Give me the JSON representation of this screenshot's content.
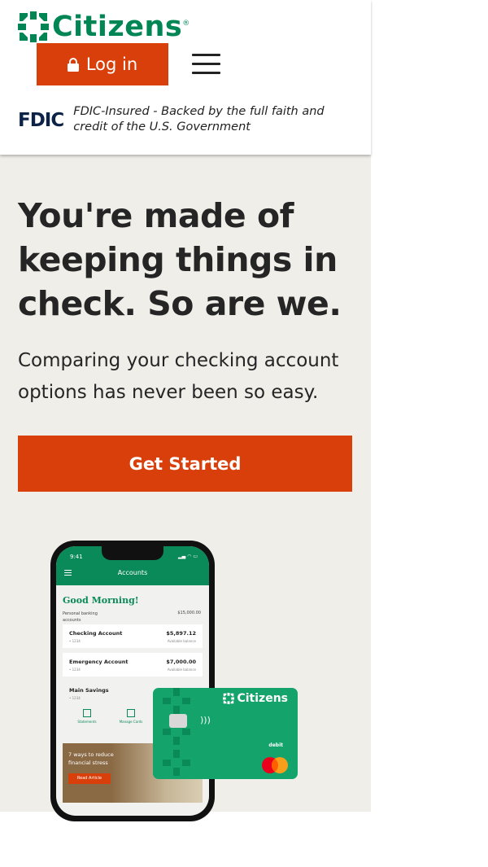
{
  "header": {
    "brand_name": "Citizens",
    "brand_tm": "®",
    "login_label": "Log in",
    "menu_icon": "hamburger-menu-icon",
    "fdic_logo": "FDIC",
    "fdic_text": "FDIC-Insured - Backed by the full faith and credit of the U.S. Government"
  },
  "hero": {
    "title": "You're made of keeping things in check. So are we.",
    "subtitle": "Comparing your checking account options has never been so easy.",
    "cta_label": "Get Started"
  },
  "phone": {
    "time": "9:41",
    "screen_title": "Accounts",
    "greeting": "Good Morning!",
    "personal_banking_label": "Personal banking accounts",
    "personal_banking_total": "$15,000.00",
    "accounts": [
      {
        "name": "Checking Account",
        "number": "• 1234",
        "balance": "$5,897.12",
        "balance_label": "Available balance"
      },
      {
        "name": "Emergency Account",
        "number": "• 1234",
        "balance": "$7,000.00",
        "balance_label": "Available balance"
      },
      {
        "name": "Main Savings",
        "number": "• 1234",
        "balance": "",
        "balance_label": ""
      }
    ],
    "quick_actions": [
      "Statements",
      "Manage Cards"
    ],
    "article_title": "7 ways to reduce financial stress",
    "article_button": "Read Article"
  },
  "card": {
    "brand": "Citizens",
    "type_label": "debit",
    "network_icon": "mastercard-logo"
  },
  "colors": {
    "brand_green": "#008555",
    "accent_orange": "#d93f0a",
    "hero_bg": "#efeee9",
    "fdic_navy": "#0c2347"
  }
}
